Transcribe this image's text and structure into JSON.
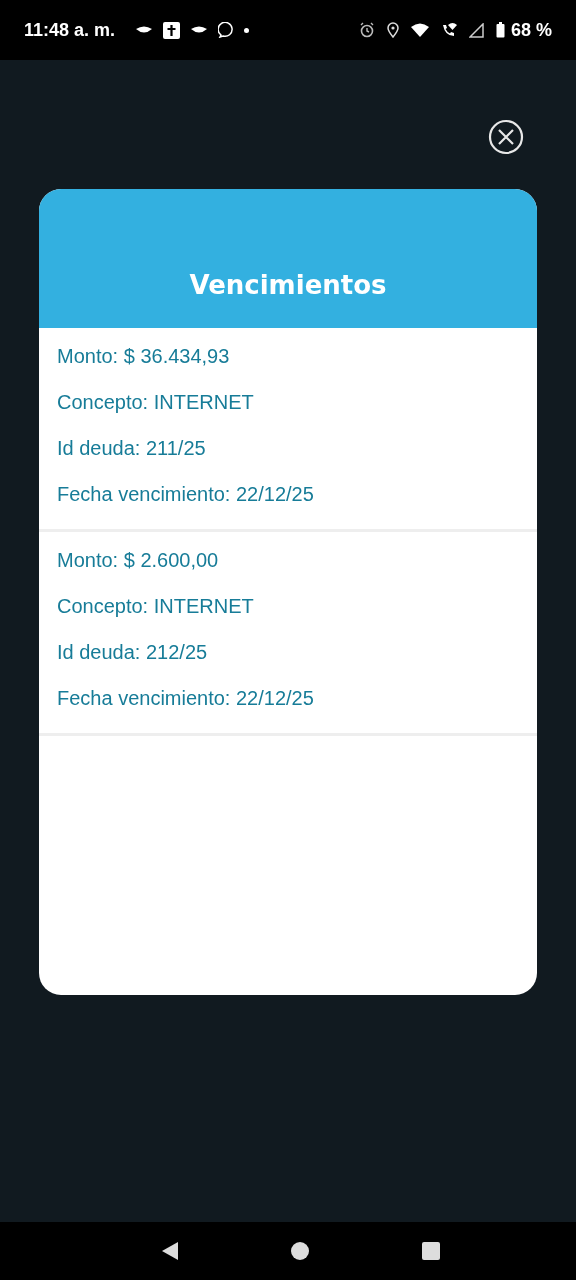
{
  "status_bar": {
    "time": "11:48 a. m.",
    "battery": "68 %"
  },
  "dialog": {
    "title": "Vencimientos",
    "items": [
      {
        "lines": [
          "Monto: $ 36.434,93",
          "Concepto: INTERNET",
          "Id deuda: 211/25",
          "Fecha vencimiento: 22/12/25"
        ]
      },
      {
        "lines": [
          "Monto: $ 2.600,00",
          "Concepto: INTERNET",
          "Id deuda: 212/25",
          "Fecha vencimiento: 22/12/25"
        ]
      }
    ]
  }
}
